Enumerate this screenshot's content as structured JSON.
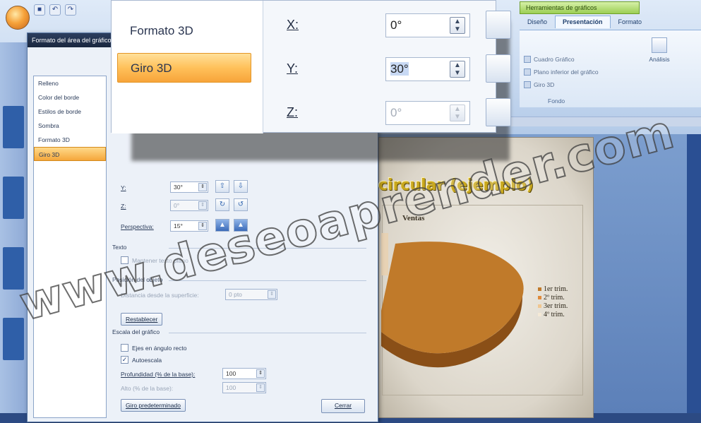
{
  "ribbon": {
    "quick_access_icons": [
      "save-icon",
      "undo-icon",
      "redo-icon"
    ],
    "context_tab_group": "Herramientas de gráficos",
    "tabs": [
      "Diseño",
      "Presentación",
      "Formato"
    ],
    "active_tab": "Presentación",
    "fondo_items": [
      "Cuadro Gráfico",
      "Plano inferior del gráfico",
      "Giro 3D"
    ],
    "fondo_group_label": "Fondo",
    "analysis_label": "Análisis"
  },
  "dialog": {
    "title": "Formato del área del gráfico",
    "nav": [
      "Relleno",
      "Color del borde",
      "Estilos de borde",
      "Sombra",
      "Formato 3D",
      "Giro 3D"
    ],
    "selected_nav": "Giro 3D",
    "rotation": {
      "y_label": "Y:",
      "y_value": "30°",
      "z_label": "Z:",
      "z_value": "0°",
      "perspective_label": "Perspectiva:",
      "perspective_value": "15°"
    },
    "text_section": "Texto",
    "keep_text_flat": "Mantener texto plano",
    "object_position_section": "Posición del objeto",
    "distance_label": "Distancia desde la superficie:",
    "distance_value": "0 pto",
    "reset_button": "Restablecer",
    "chart_scale_section": "Escala del gráfico",
    "right_angle_axes": "Ejes en ángulo recto",
    "autoscale": "Autoescala",
    "depth_label": "Profundidad (% de la base):",
    "depth_value": "100",
    "height_label": "Alto (% de la base):",
    "height_value": "100",
    "default_rotation_button": "Giro predeterminado",
    "close_button": "Cerrar"
  },
  "zoom": {
    "nav": [
      "Formato 3D",
      "Giro 3D"
    ],
    "selected_nav": "Giro 3D",
    "x_label": "X:",
    "x_value": "0°",
    "y_label": "Y:",
    "y_value": "30°",
    "z_label": "Z:",
    "z_value": "0°"
  },
  "chart": {
    "title": "circular (ejemplo)",
    "series_label": "Ventas",
    "legend": [
      {
        "label": "1er trim.",
        "color": "#c07a2a"
      },
      {
        "label": "2º trim.",
        "color": "#e08a3a"
      },
      {
        "label": "3er trim.",
        "color": "#f0c690"
      },
      {
        "label": "4º trim.",
        "color": "#f4e9d6"
      }
    ]
  },
  "watermark": "www.deseoaprender.com",
  "colors": {
    "accent_orange": "#f7a43a",
    "title_bar": "#1a273f",
    "context_tab_green": "#9ccf54",
    "pie_main": "#c07a2a"
  }
}
